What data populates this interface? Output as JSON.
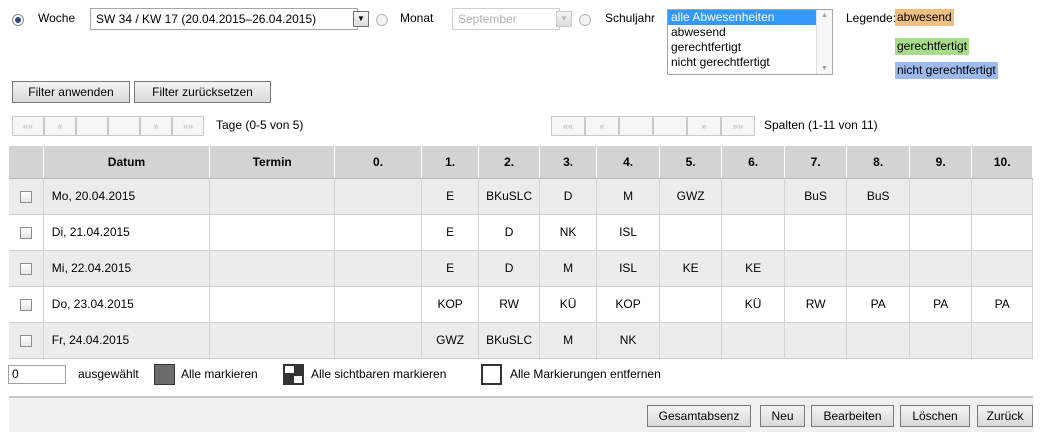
{
  "period": {
    "week_label": "Woche",
    "week_value": "SW 34 / KW 17 (20.04.2015–26.04.2015)",
    "month_label": "Monat",
    "month_value": "September",
    "schoolyear_label": "Schuljahr"
  },
  "absence_filter": {
    "options": [
      "alle Abwesenheiten",
      "abwesend",
      "gerechtfertigt",
      "nicht gerechtfertigt"
    ],
    "selected_index": 0
  },
  "legend": {
    "label": "Legende:",
    "items": [
      {
        "text": "abwesend",
        "color": "#f0c080"
      },
      {
        "text": "gerechtfertigt",
        "color": "#a8dc8a"
      },
      {
        "text": "nicht gerechtfertigt",
        "color": "#9db9ee"
      }
    ]
  },
  "filter_buttons": {
    "apply": "Filter anwenden",
    "reset": "Filter zurücksetzen"
  },
  "paging": {
    "days_label": "Tage (0-5 von 5)",
    "columns_label": "Spalten (1-11 von 11)",
    "first_icon": "««",
    "prev_icon": "«",
    "next_icon": "»",
    "last_icon": "»»"
  },
  "table": {
    "headers": [
      "",
      "Datum",
      "Termin",
      "0.",
      "1.",
      "2.",
      "3.",
      "4.",
      "5.",
      "6.",
      "7.",
      "8.",
      "9.",
      "10."
    ],
    "rows": [
      [
        "",
        "Mo, 20.04.2015",
        "",
        "",
        "E",
        "BKuSLC",
        "D",
        "M",
        "GWZ",
        "",
        "BuS",
        "BuS",
        "",
        ""
      ],
      [
        "",
        "Di, 21.04.2015",
        "",
        "",
        "E",
        "D",
        "NK",
        "ISL",
        "",
        "",
        "",
        "",
        "",
        ""
      ],
      [
        "",
        "Mi, 22.04.2015",
        "",
        "",
        "E",
        "D",
        "M",
        "ISL",
        "KE",
        "KE",
        "",
        "",
        "",
        ""
      ],
      [
        "",
        "Do, 23.04.2015",
        "",
        "",
        "KOP",
        "RW",
        "KÜ",
        "KOP",
        "",
        "KÜ",
        "RW",
        "PA",
        "PA",
        "PA"
      ],
      [
        "",
        "Fr, 24.04.2015",
        "",
        "",
        "GWZ",
        "BKuSLC",
        "M",
        "NK",
        "",
        "",
        "",
        "",
        "",
        ""
      ]
    ]
  },
  "selection": {
    "count": "0",
    "selected_label": "ausgewählt",
    "mark_all": "Alle markieren",
    "mark_visible": "Alle sichtbaren markieren",
    "unmark_all": "Alle Markierungen entfernen"
  },
  "actions": {
    "total_absence": "Gesamtabsenz",
    "new": "Neu",
    "edit": "Bearbeiten",
    "delete": "Löschen",
    "back": "Zurück"
  }
}
